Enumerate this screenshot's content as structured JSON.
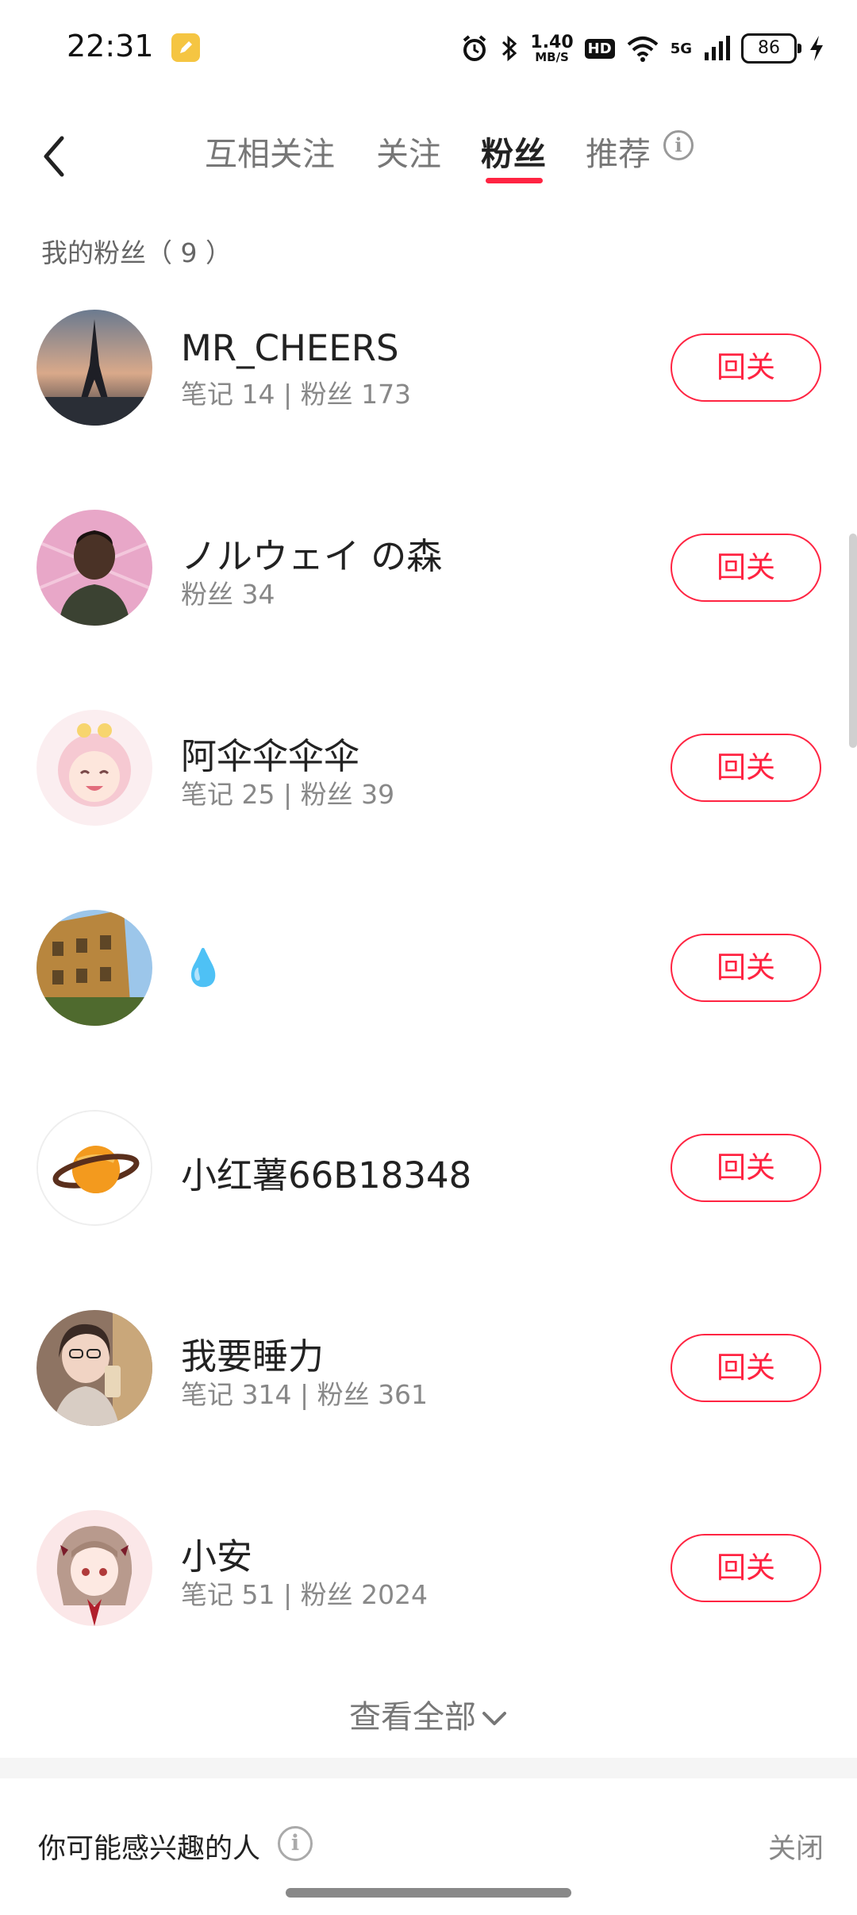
{
  "status_bar": {
    "time": "22:31",
    "net_speed_value": "1.40",
    "net_speed_unit": "MB/S",
    "hd_label": "HD",
    "network_type": "5G",
    "battery_level": "86"
  },
  "nav": {
    "tabs": [
      {
        "label": "互相关注",
        "active": false
      },
      {
        "label": "关注",
        "active": false
      },
      {
        "label": "粉丝",
        "active": true
      },
      {
        "label": "推荐",
        "active": false
      }
    ]
  },
  "fans_section": {
    "label": "我的粉丝（ 9 ）"
  },
  "followers": [
    {
      "name": "MR_CHEERS",
      "stats": "笔记 14 | 粉丝 173",
      "button": "回关",
      "avatar_icon": "eiffel-tower-avatar"
    },
    {
      "name": "ノルウェイ の森",
      "stats": "粉丝 34",
      "button": "回关",
      "avatar_icon": "person-pink-avatar"
    },
    {
      "name": "阿伞伞伞伞",
      "stats": "笔记 25 | 粉丝 39",
      "button": "回关",
      "avatar_icon": "anime-girl-avatar"
    },
    {
      "name": "💧",
      "stats": "",
      "button": "回关",
      "avatar_icon": "building-avatar"
    },
    {
      "name": "小红薯66B18348",
      "stats": "",
      "button": "回关",
      "avatar_icon": "planet-avatar"
    },
    {
      "name": "我要睡力",
      "stats": "笔记 314 | 粉丝 361",
      "button": "回关",
      "avatar_icon": "selfie-girl-avatar"
    },
    {
      "name": "小安",
      "stats": "笔记 51 | 粉丝 2024",
      "button": "回关",
      "avatar_icon": "illustrated-girl-avatar"
    }
  ],
  "view_all": {
    "label": "查看全部"
  },
  "recommend": {
    "title": "你可能感兴趣的人",
    "close_label": "关闭"
  },
  "colors": {
    "accent": "#ff2442",
    "text_primary": "#222222",
    "text_secondary": "#888888"
  }
}
